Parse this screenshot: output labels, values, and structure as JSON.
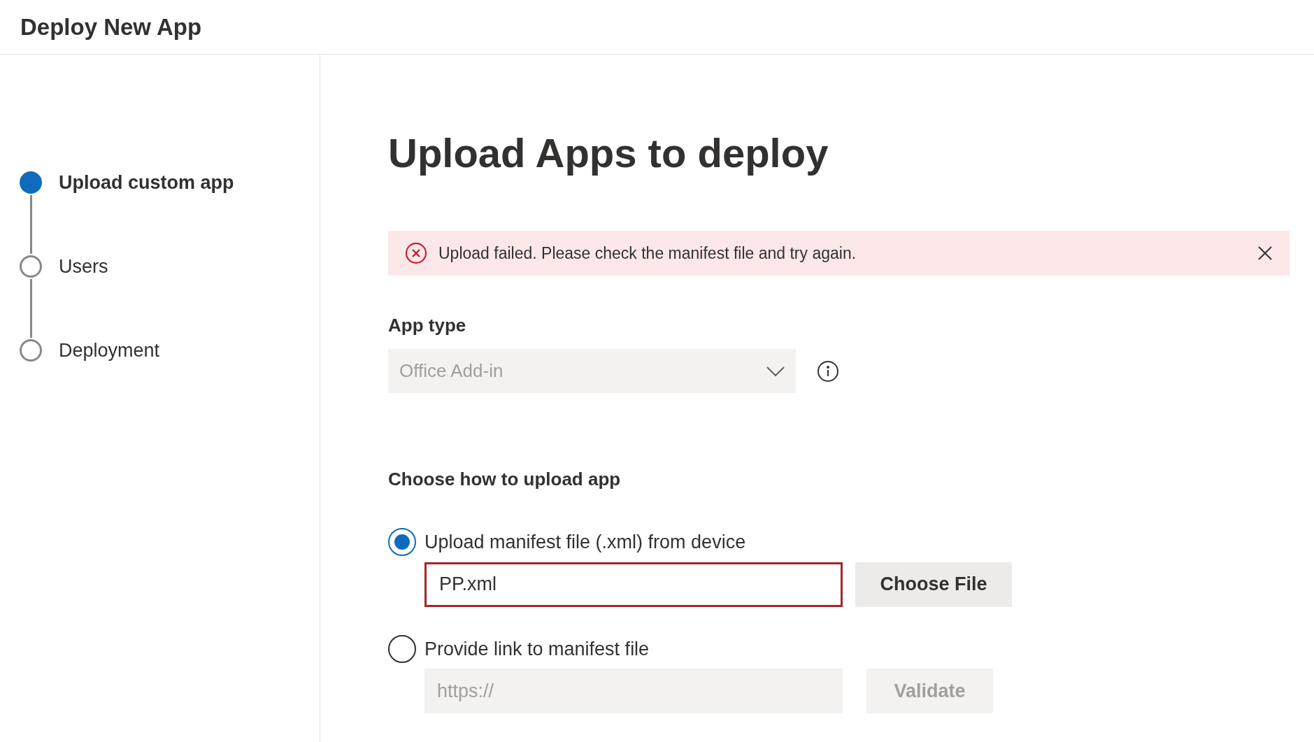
{
  "header": {
    "title": "Deploy New App"
  },
  "steps": [
    {
      "label": "Upload custom app",
      "selected": true
    },
    {
      "label": "Users",
      "selected": false
    },
    {
      "label": "Deployment",
      "selected": false
    }
  ],
  "page_title": "Upload Apps to deploy",
  "alert": {
    "kind": "error",
    "message": "Upload failed. Please check the manifest file and try again."
  },
  "app_type": {
    "label": "App type",
    "value": "Office Add-in",
    "disabled": true
  },
  "upload_section": {
    "title": "Choose how to upload app",
    "options": [
      {
        "label": "Upload manifest file (.xml) from device",
        "selected": true,
        "field": {
          "value": "PP.xml",
          "invalid": true
        },
        "button": {
          "label": "Choose File",
          "disabled": false
        }
      },
      {
        "label": "Provide link to manifest file",
        "selected": false,
        "field": {
          "placeholder": "https://",
          "invalid": false
        },
        "button": {
          "label": "Validate",
          "disabled": true
        }
      }
    ]
  }
}
